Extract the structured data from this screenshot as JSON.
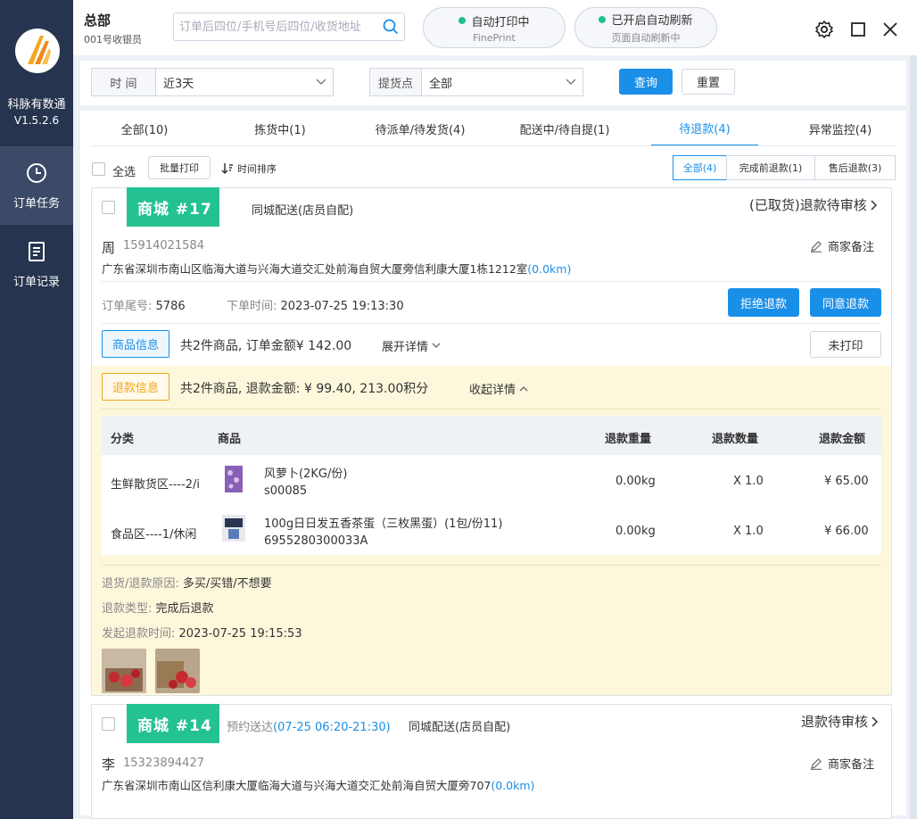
{
  "app": {
    "name": "科脉有数通",
    "version": "V1.5.2.6"
  },
  "nav": [
    {
      "label": "订单任务",
      "icon": "clock-icon",
      "active": true
    },
    {
      "label": "订单记录",
      "icon": "document-icon",
      "active": false
    }
  ],
  "header": {
    "store": "总部",
    "cashier": "001号收银员",
    "search_placeholder": "订单后四位/手机号后四位/收货地址",
    "status": [
      {
        "title": "自动打印中",
        "sub": "FinePrint"
      },
      {
        "title": "已开启自动刷新",
        "sub": "页面自动刷新中"
      }
    ]
  },
  "filter": {
    "time_label": "时 间",
    "time_value": "近3天",
    "pickup_label": "提货点",
    "pickup_value": "全部",
    "query": "查询",
    "reset": "重置"
  },
  "tabs": [
    {
      "label": "全部(10)",
      "active": false
    },
    {
      "label": "拣货中(1)",
      "active": false
    },
    {
      "label": "待派单/待发货(4)",
      "active": false
    },
    {
      "label": "配送中/待自提(1)",
      "active": false
    },
    {
      "label": "待退款(4)",
      "active": true
    },
    {
      "label": "异常监控(4)",
      "active": false
    }
  ],
  "toolbar": {
    "select_all": "全选",
    "batch_print": "批量打印",
    "time_sort": "时间排序",
    "segments": [
      {
        "label": "全部(4)",
        "active": true
      },
      {
        "label": "完成前退款(1)",
        "active": false
      },
      {
        "label": "售后退款(3)",
        "active": false
      }
    ]
  },
  "orders": [
    {
      "badge": "商城 #17",
      "delivery": "同城配送(店员自配)",
      "status": "(已取货)退款待审核",
      "customer": "周",
      "phone": "15914021584",
      "address": "广东省深圳市南山区临海大道与兴海大道交汇处前海自贸大厦旁信利康大厦1栋1212室",
      "distance": "(0.0km)",
      "merchant_note": "商家备注",
      "tail_label": "订单尾号:",
      "tail_value": "5786",
      "time_label": "下单时间:",
      "time_value": "2023-07-25 19:13:30",
      "reject": "拒绝退款",
      "approve": "同意退款",
      "goods_tag": "商品信息",
      "goods_summary": "共2件商品, 订单金额¥ 142.00",
      "expand": "展开详情",
      "print_status": "未打印",
      "refund_tag": "退款信息",
      "refund_summary": "共2件商品, 退款金额: ¥ 99.40, 213.00积分",
      "collapse": "收起详情",
      "table_headers": [
        "分类",
        "商品",
        "退款重量",
        "退款数量",
        "退款金额"
      ],
      "items": [
        {
          "category": "生鲜散货区----2/i",
          "name": "风萝卜(2KG/份)",
          "code": "s00085",
          "weight": "0.00kg",
          "qty": "X 1.0",
          "amount": "¥ 65.00"
        },
        {
          "category": "食品区----1/休闲",
          "name": "100g日日发五香茶蛋（三枚黑蛋）(1包/份11)",
          "code": "6955280300033A",
          "weight": "0.00kg",
          "qty": "X 1.0",
          "amount": "¥ 66.00"
        }
      ],
      "reason_label": "退货/退款原因:",
      "reason": "多买/买错/不想要",
      "type_label": "退款类型:",
      "type": "完成后退款",
      "refund_time_label": "发起退款时间:",
      "refund_time": "2023-07-25 19:15:53"
    },
    {
      "badge": "商城 #14",
      "appointment_label": "预约送达",
      "appointment": "(07-25 06:20-21:30)",
      "delivery": "同城配送(店员自配)",
      "status": "退款待审核",
      "customer": "李",
      "phone": "15323894427",
      "address": "广东省深圳市南山区信利康大厦临海大道与兴海大道交汇处前海自贸大厦旁707",
      "distance": "(0.0km)",
      "merchant_note": "商家备注"
    }
  ],
  "colors": {
    "sidebar": "#27344f",
    "primary": "#1a8fe8",
    "badge": "#24c292",
    "refund_bg": "#fdf7dc",
    "warning": "#f2a51a"
  }
}
